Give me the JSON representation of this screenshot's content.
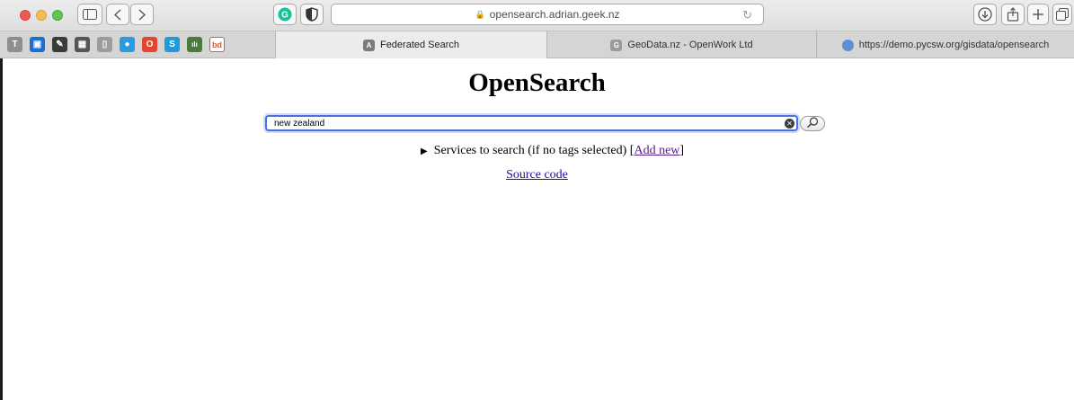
{
  "browser": {
    "url": "opensearch.adrian.geek.nz",
    "tabs": [
      {
        "label": "Federated Search",
        "icon_letter": "A",
        "icon_color": "#7a7a7a"
      },
      {
        "label": "GeoData.nz - OpenWork Ltd",
        "icon_letter": "G",
        "icon_color": "#9a9a9a"
      },
      {
        "label": "https://demo.pycsw.org/gisdata/opensearch",
        "icon_letter": "",
        "icon_color": "#5b8fd6"
      }
    ],
    "favorites": [
      {
        "icon": "t-icon",
        "letter": "T",
        "color": "#8e8e8e"
      },
      {
        "icon": "trello-icon",
        "letter": "▣",
        "color": "#1c6fd0"
      },
      {
        "icon": "pen-icon",
        "letter": "✎",
        "color": "#3b3b3b"
      },
      {
        "icon": "qr-icon",
        "letter": "▦",
        "color": "#555555"
      },
      {
        "icon": "phone-icon",
        "letter": "▯",
        "color": "#9c9c9c"
      },
      {
        "icon": "chat-icon",
        "letter": "●",
        "color": "#2a9be0"
      },
      {
        "icon": "opera-icon",
        "letter": "O",
        "color": "#e5452f"
      },
      {
        "icon": "s-icon",
        "letter": "S",
        "color": "#1e9bd8"
      },
      {
        "icon": "bars-icon",
        "letter": "ılı",
        "color": "#4c7a3e"
      },
      {
        "icon": "bd-icon",
        "letter": "bd",
        "color": "#e05a2a"
      }
    ]
  },
  "page": {
    "title": "OpenSearch",
    "search": {
      "value": "new zealand",
      "placeholder": ""
    },
    "services": {
      "triangle": "▶",
      "text_prefix": "Services to search (if no tags selected) [",
      "add_new": "Add new",
      "text_suffix": "]"
    },
    "source_code": "Source code"
  }
}
